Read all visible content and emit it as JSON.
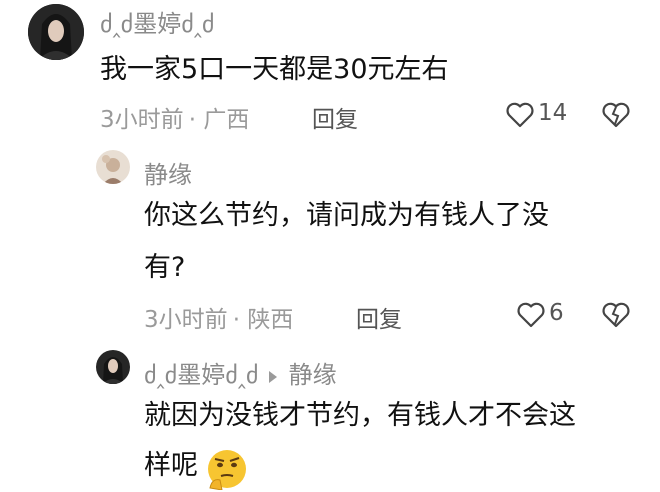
{
  "comments": [
    {
      "user": "ძ‸ძ墨婷ძ‸ძ",
      "text": "我一家5口一天都是30元左右",
      "time": "3小时前",
      "location": "广西",
      "reply_label": "回复",
      "likes": "14"
    },
    {
      "user": "静缘",
      "text_line1": "你这么节约，请问成为有钱人了没",
      "text_line2": "有?",
      "time": "3小时前",
      "location": "陕西",
      "reply_label": "回复",
      "likes": "6"
    },
    {
      "user": "ძ‸ძ墨婷ძ‸ძ",
      "reply_to": "静缘",
      "text_line1": "就因为没钱才节约，有钱人才不会这",
      "text_line2": "样呢"
    }
  ],
  "icons": {
    "like": "heart-outline-icon",
    "dislike": "broken-heart-outline-icon",
    "arrow": "reply-arrow-icon",
    "emoji": "thinking-face-emoji-icon"
  },
  "colors": {
    "username": "#8a8a8a",
    "text": "#111111",
    "meta": "#9a9a9a"
  }
}
